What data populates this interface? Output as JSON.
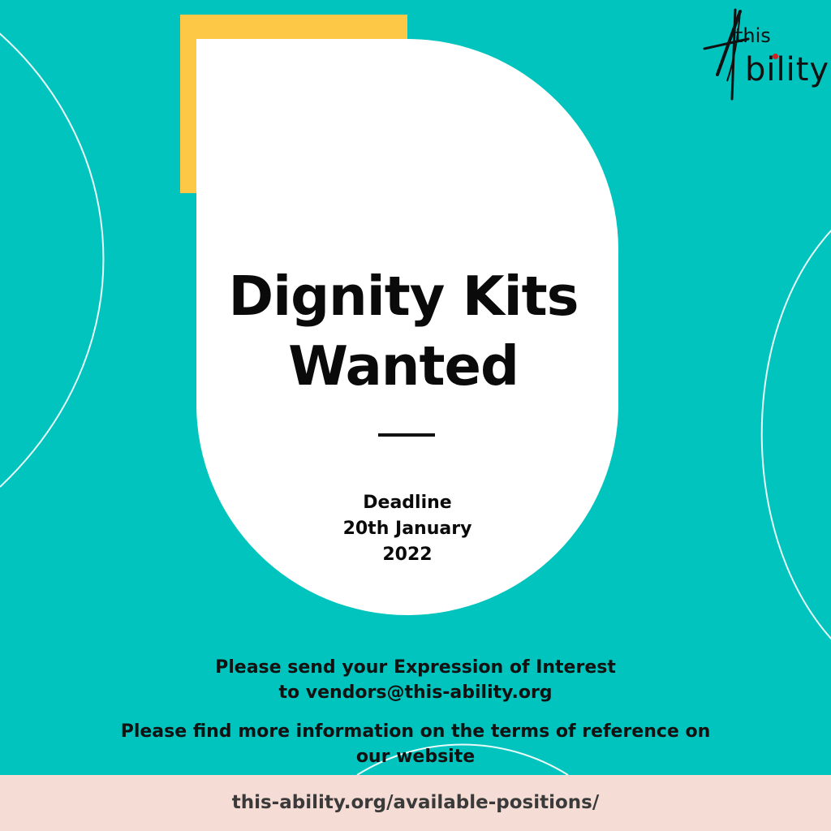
{
  "colors": {
    "background": "#00c4bd",
    "accent_yellow": "#fdc845",
    "card": "#ffffff",
    "footer_band": "#f5dcd5",
    "logo_dot": "#d42020",
    "text": "#0a0a0a"
  },
  "logo": {
    "word_top": "this",
    "word_bottom": "bility",
    "icon": "stylized-A-logo-icon"
  },
  "headline": {
    "line1": "Dignity Kits",
    "line2": "Wanted"
  },
  "deadline": {
    "label": "Deadline",
    "date": "20th January",
    "year": "2022"
  },
  "info": {
    "send_line1": "Please send your Expression of Interest",
    "send_line2": "to vendors@this-ability.org",
    "more_line1": "Please find more information on the terms of reference on",
    "more_line2": "our website"
  },
  "footer": {
    "url": "this-ability.org/available-positions/"
  }
}
